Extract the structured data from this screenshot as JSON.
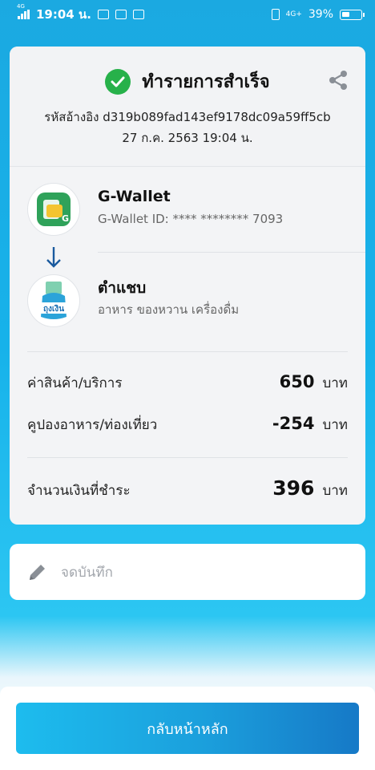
{
  "status_bar": {
    "network": "4G",
    "time": "19:04 น.",
    "right_network": "4G+",
    "battery": "39%"
  },
  "header": {
    "title": "ทำรายการสำเร็จ",
    "reference_label": "รหัสอ้างอิง",
    "reference_id": "d319b089fad143ef9178dc09a59ff5cb",
    "datetime": "27 ก.ค. 2563 19:04 น."
  },
  "from": {
    "name": "G-Wallet",
    "detail": "G-Wallet ID: **** ********  7093"
  },
  "to": {
    "name": "ตำแชบ",
    "detail": "อาหาร ของหวาน เครื่องดื่ม",
    "logo_text": "ถุงเงิน"
  },
  "amounts": {
    "item_label": "ค่าสินค้า/บริการ",
    "item_value": "650",
    "coupon_label": "คูปองอาหาร/ท่องเที่ยว",
    "coupon_value": "-254",
    "total_label": "จำนวนเงินที่ชำระ",
    "total_value": "396",
    "unit": "บาท"
  },
  "note": {
    "placeholder": "จดบันทึก"
  },
  "footer": {
    "home_button": "กลับหน้าหลัก"
  },
  "colors": {
    "success": "#27b14a",
    "background": "#1ba9e1",
    "button": "#1b9fdc"
  }
}
